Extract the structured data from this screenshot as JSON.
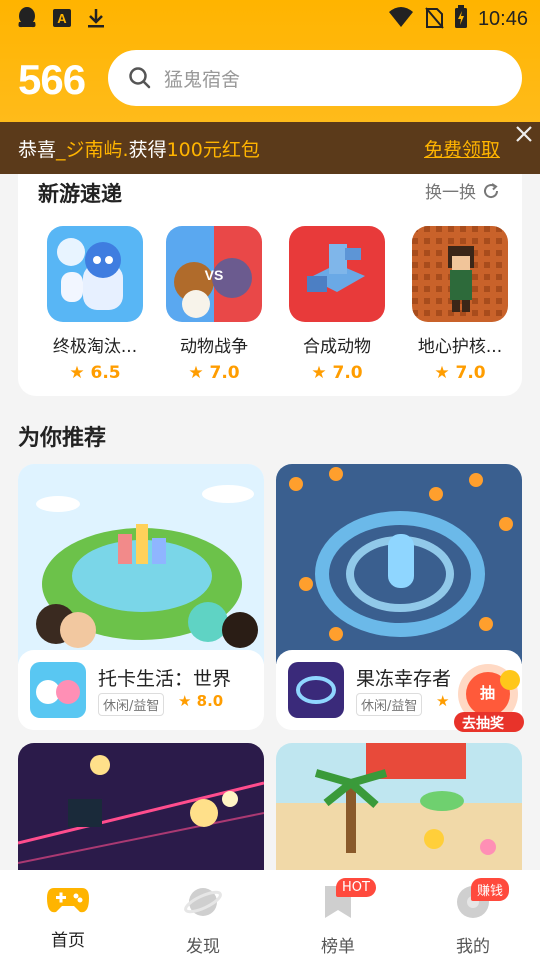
{
  "status": {
    "time": "10:46"
  },
  "header": {
    "logo": "566",
    "search_placeholder": "猛鬼宿舍"
  },
  "banner": {
    "prefix": "恭喜",
    "user": "_ジ南屿.",
    "mid": "获得",
    "prize": "100元红包",
    "link": "免费领取"
  },
  "new_games": {
    "title": "新游速递",
    "refresh": "换一换",
    "items": [
      {
        "name": "终极淘汰...",
        "score": "6.5"
      },
      {
        "name": "动物战争",
        "score": "7.0"
      },
      {
        "name": "合成动物",
        "score": "7.0"
      },
      {
        "name": "地心护核...",
        "score": "7.0"
      }
    ]
  },
  "recommend": {
    "title": "为你推荐",
    "cards": [
      {
        "name": "托卡生活：世界",
        "tag": "休闲/益智",
        "score": "8.0"
      },
      {
        "name": "果冻幸存者",
        "tag": "休闲/益智",
        "score": ""
      }
    ]
  },
  "lottery": {
    "char": "抽",
    "label": "去抽奖"
  },
  "tabs": [
    {
      "label": "首页",
      "badge": ""
    },
    {
      "label": "发现",
      "badge": ""
    },
    {
      "label": "榜单",
      "badge": "HOT"
    },
    {
      "label": "我的",
      "badge": "赚钱"
    }
  ],
  "colors": {
    "accent": "#ffb400",
    "score": "#ff9d00",
    "banner_bg": "#5b3a1a"
  }
}
